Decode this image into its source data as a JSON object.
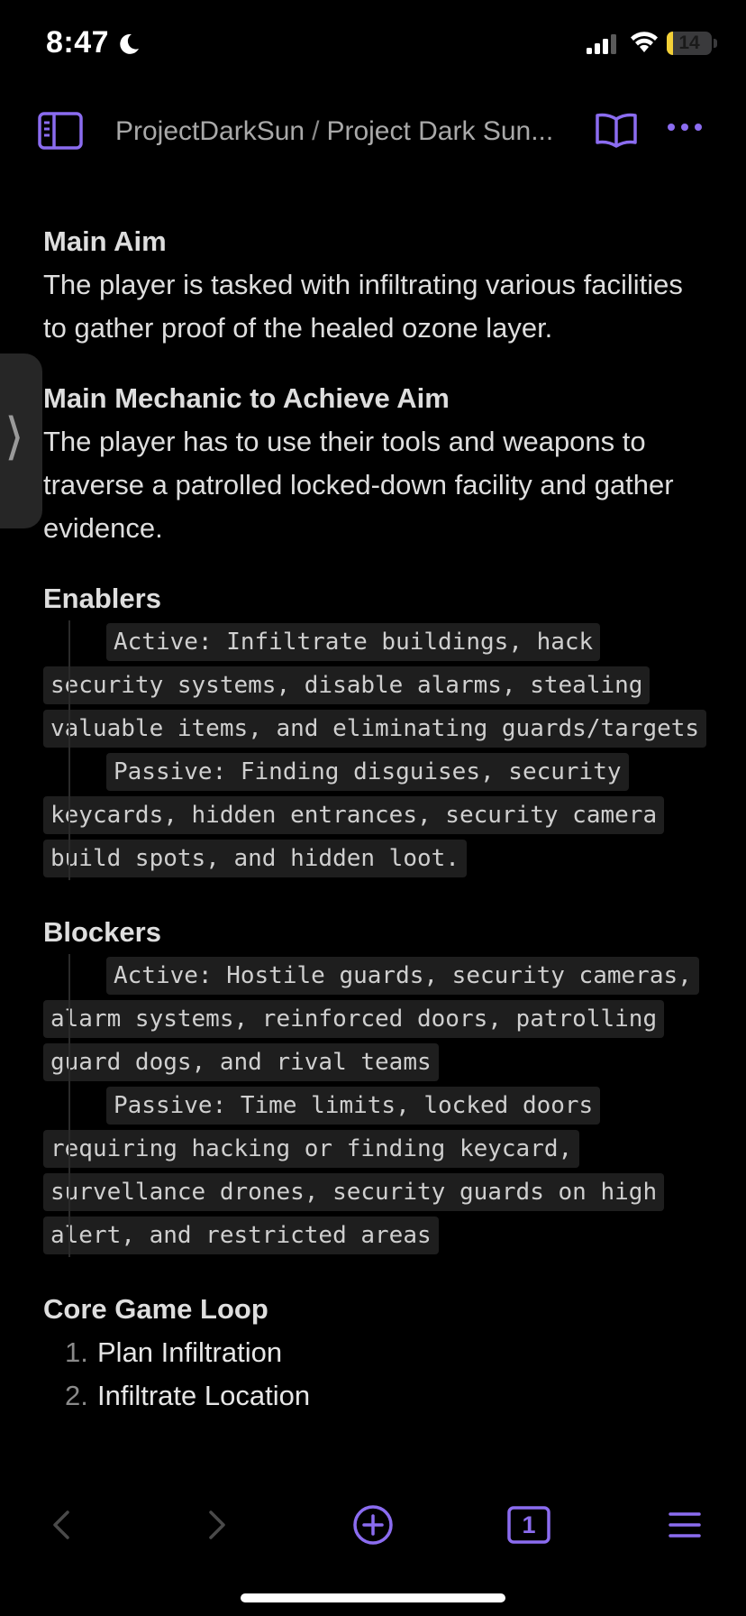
{
  "status_bar": {
    "time": "8:47",
    "battery_level": "14",
    "battery_fraction": 0.14
  },
  "header": {
    "vault_name": "ProjectDarkSun",
    "separator": "/",
    "note_title": "Project Dark Sun..."
  },
  "colors": {
    "accent": "#8b6cf0",
    "background": "#000000",
    "text": "#dedede",
    "code_background": "#1e1e1e"
  },
  "sections": {
    "main_aim": {
      "heading": "Main Aim",
      "text": "The player is tasked with infiltrating various facilities to gather proof of the healed ozone layer."
    },
    "main_mechanic": {
      "heading": "Main Mechanic to Achieve Aim",
      "text": "The player has to use their tools and weapons to traverse a patrolled locked-down facility and gather evidence."
    },
    "enablers": {
      "heading": "Enablers",
      "active": "Active: Infiltrate buildings, hack security systems, disable alarms, stealing valuable items, and eliminating guards/targets",
      "passive": "Passive: Finding disguises, security keycards, hidden entrances, security camera build spots, and hidden loot."
    },
    "blockers": {
      "heading": "Blockers",
      "active": "Active: Hostile guards, security cameras, alarm systems, reinforced doors, patrolling guard dogs, and rival teams",
      "passive": "Passive: Time limits, locked doors requiring hacking or finding keycard, survellance drones, security guards on high alert, and restricted areas"
    },
    "core_loop": {
      "heading": "Core Game Loop",
      "items": [
        {
          "num": "1.",
          "label": "Plan Infiltration"
        },
        {
          "num": "2.",
          "label": "Infiltrate Location"
        }
      ]
    }
  },
  "toolbar": {
    "tab_count": "1",
    "icons": [
      "back-arrow-icon",
      "forward-arrow-icon",
      "new-note-plus-icon",
      "tabs-icon",
      "menu-icon"
    ]
  }
}
